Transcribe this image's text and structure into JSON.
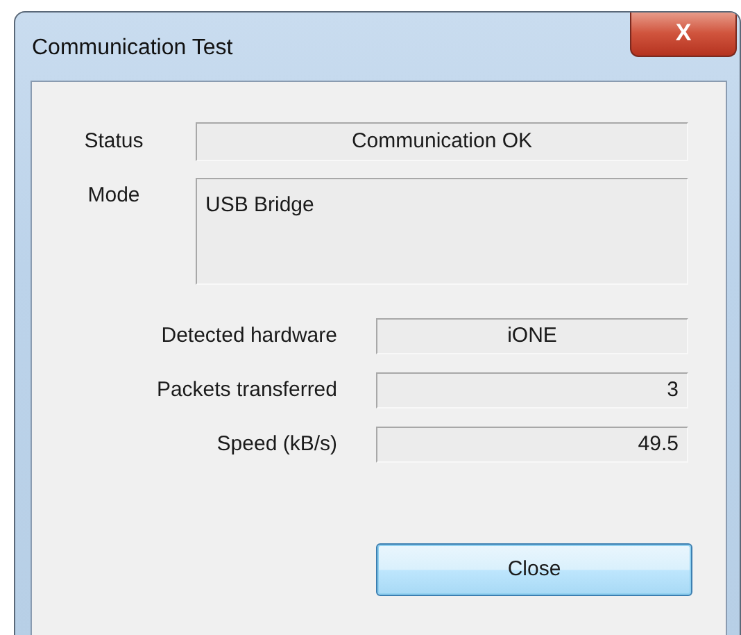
{
  "window": {
    "title": "Communication Test",
    "close_glyph": "X"
  },
  "status": {
    "label": "Status",
    "value": "Communication OK"
  },
  "mode": {
    "label": "Mode",
    "value": "USB Bridge"
  },
  "details": [
    {
      "label": "Detected hardware",
      "value": "iONE",
      "kind": "centered"
    },
    {
      "label": "Packets transferred",
      "value": "3",
      "kind": "numeric"
    },
    {
      "label": "Speed (kB/s)",
      "value": "49.5",
      "kind": "numeric"
    }
  ],
  "buttons": [
    "Close"
  ]
}
